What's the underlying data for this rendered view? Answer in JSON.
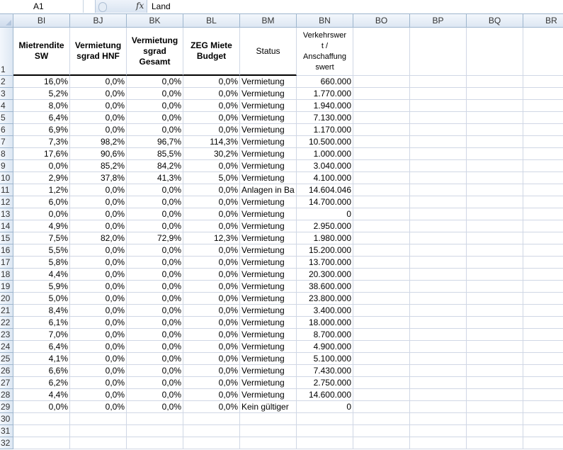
{
  "formula_bar": {
    "name_box": "A1",
    "fx_label": "fx",
    "content": "Land"
  },
  "columns": [
    "BI",
    "BJ",
    "BK",
    "BL",
    "BM",
    "BN",
    "BO",
    "BP",
    "BQ",
    "BR"
  ],
  "header_row": {
    "row_number": "1",
    "cells": [
      "Mietrendite SW",
      "Vermietung sgrad HNF",
      "Vermietung sgrad Gesamt",
      "ZEG Miete Budget",
      "Status",
      "Verkehrswert / Anschaffungswert"
    ],
    "bn_lines": [
      "Verkehrswer",
      "t /",
      "Anschaffung",
      "swert"
    ]
  },
  "rows": [
    {
      "n": "2",
      "bi": "16,0%",
      "bj": "0,0%",
      "bk": "0,0%",
      "bl": "0,0%",
      "bm": "Vermietung",
      "bn": "660.000"
    },
    {
      "n": "3",
      "bi": "5,2%",
      "bj": "0,0%",
      "bk": "0,0%",
      "bl": "0,0%",
      "bm": "Vermietung",
      "bn": "1.770.000"
    },
    {
      "n": "4",
      "bi": "8,0%",
      "bj": "0,0%",
      "bk": "0,0%",
      "bl": "0,0%",
      "bm": "Vermietung",
      "bn": "1.940.000"
    },
    {
      "n": "5",
      "bi": "6,4%",
      "bj": "0,0%",
      "bk": "0,0%",
      "bl": "0,0%",
      "bm": "Vermietung",
      "bn": "7.130.000"
    },
    {
      "n": "6",
      "bi": "6,9%",
      "bj": "0,0%",
      "bk": "0,0%",
      "bl": "0,0%",
      "bm": "Vermietung",
      "bn": "1.170.000"
    },
    {
      "n": "7",
      "bi": "7,3%",
      "bj": "98,2%",
      "bk": "96,7%",
      "bl": "114,3%",
      "bm": "Vermietung",
      "bn": "10.500.000"
    },
    {
      "n": "8",
      "bi": "17,6%",
      "bj": "90,6%",
      "bk": "85,5%",
      "bl": "30,2%",
      "bm": "Vermietung",
      "bn": "1.000.000"
    },
    {
      "n": "9",
      "bi": "0,0%",
      "bj": "85,2%",
      "bk": "84,2%",
      "bl": "0,0%",
      "bm": "Vermietung",
      "bn": "3.040.000"
    },
    {
      "n": "10",
      "bi": "2,9%",
      "bj": "37,8%",
      "bk": "41,3%",
      "bl": "5,0%",
      "bm": "Vermietung",
      "bn": "4.100.000"
    },
    {
      "n": "11",
      "bi": "1,2%",
      "bj": "0,0%",
      "bk": "0,0%",
      "bl": "0,0%",
      "bm": "Anlagen in Ba",
      "bn": "14.604.046"
    },
    {
      "n": "12",
      "bi": "6,0%",
      "bj": "0,0%",
      "bk": "0,0%",
      "bl": "0,0%",
      "bm": "Vermietung",
      "bn": "14.700.000"
    },
    {
      "n": "13",
      "bi": "0,0%",
      "bj": "0,0%",
      "bk": "0,0%",
      "bl": "0,0%",
      "bm": "Vermietung",
      "bn": "0"
    },
    {
      "n": "14",
      "bi": "4,9%",
      "bj": "0,0%",
      "bk": "0,0%",
      "bl": "0,0%",
      "bm": "Vermietung",
      "bn": "2.950.000"
    },
    {
      "n": "15",
      "bi": "7,5%",
      "bj": "82,0%",
      "bk": "72,9%",
      "bl": "12,3%",
      "bm": "Vermietung",
      "bn": "1.980.000"
    },
    {
      "n": "16",
      "bi": "5,5%",
      "bj": "0,0%",
      "bk": "0,0%",
      "bl": "0,0%",
      "bm": "Vermietung",
      "bn": "15.200.000"
    },
    {
      "n": "17",
      "bi": "5,8%",
      "bj": "0,0%",
      "bk": "0,0%",
      "bl": "0,0%",
      "bm": "Vermietung",
      "bn": "13.700.000"
    },
    {
      "n": "18",
      "bi": "4,4%",
      "bj": "0,0%",
      "bk": "0,0%",
      "bl": "0,0%",
      "bm": "Vermietung",
      "bn": "20.300.000"
    },
    {
      "n": "19",
      "bi": "5,9%",
      "bj": "0,0%",
      "bk": "0,0%",
      "bl": "0,0%",
      "bm": "Vermietung",
      "bn": "38.600.000"
    },
    {
      "n": "20",
      "bi": "5,0%",
      "bj": "0,0%",
      "bk": "0,0%",
      "bl": "0,0%",
      "bm": "Vermietung",
      "bn": "23.800.000"
    },
    {
      "n": "21",
      "bi": "8,4%",
      "bj": "0,0%",
      "bk": "0,0%",
      "bl": "0,0%",
      "bm": "Vermietung",
      "bn": "3.400.000"
    },
    {
      "n": "22",
      "bi": "6,1%",
      "bj": "0,0%",
      "bk": "0,0%",
      "bl": "0,0%",
      "bm": "Vermietung",
      "bn": "18.000.000"
    },
    {
      "n": "23",
      "bi": "7,0%",
      "bj": "0,0%",
      "bk": "0,0%",
      "bl": "0,0%",
      "bm": "Vermietung",
      "bn": "8.700.000"
    },
    {
      "n": "24",
      "bi": "6,4%",
      "bj": "0,0%",
      "bk": "0,0%",
      "bl": "0,0%",
      "bm": "Vermietung",
      "bn": "4.900.000"
    },
    {
      "n": "25",
      "bi": "4,1%",
      "bj": "0,0%",
      "bk": "0,0%",
      "bl": "0,0%",
      "bm": "Vermietung",
      "bn": "5.100.000"
    },
    {
      "n": "26",
      "bi": "6,6%",
      "bj": "0,0%",
      "bk": "0,0%",
      "bl": "0,0%",
      "bm": "Vermietung",
      "bn": "7.430.000"
    },
    {
      "n": "27",
      "bi": "6,2%",
      "bj": "0,0%",
      "bk": "0,0%",
      "bl": "0,0%",
      "bm": "Vermietung",
      "bn": "2.750.000"
    },
    {
      "n": "28",
      "bi": "4,4%",
      "bj": "0,0%",
      "bk": "0,0%",
      "bl": "0,0%",
      "bm": "Vermietung",
      "bn": "14.600.000"
    },
    {
      "n": "29",
      "bi": "0,0%",
      "bj": "0,0%",
      "bk": "0,0%",
      "bl": "0,0%",
      "bm": "Kein gültiger",
      "bn": "0"
    }
  ],
  "empty_rows": [
    "30",
    "31",
    "32"
  ]
}
